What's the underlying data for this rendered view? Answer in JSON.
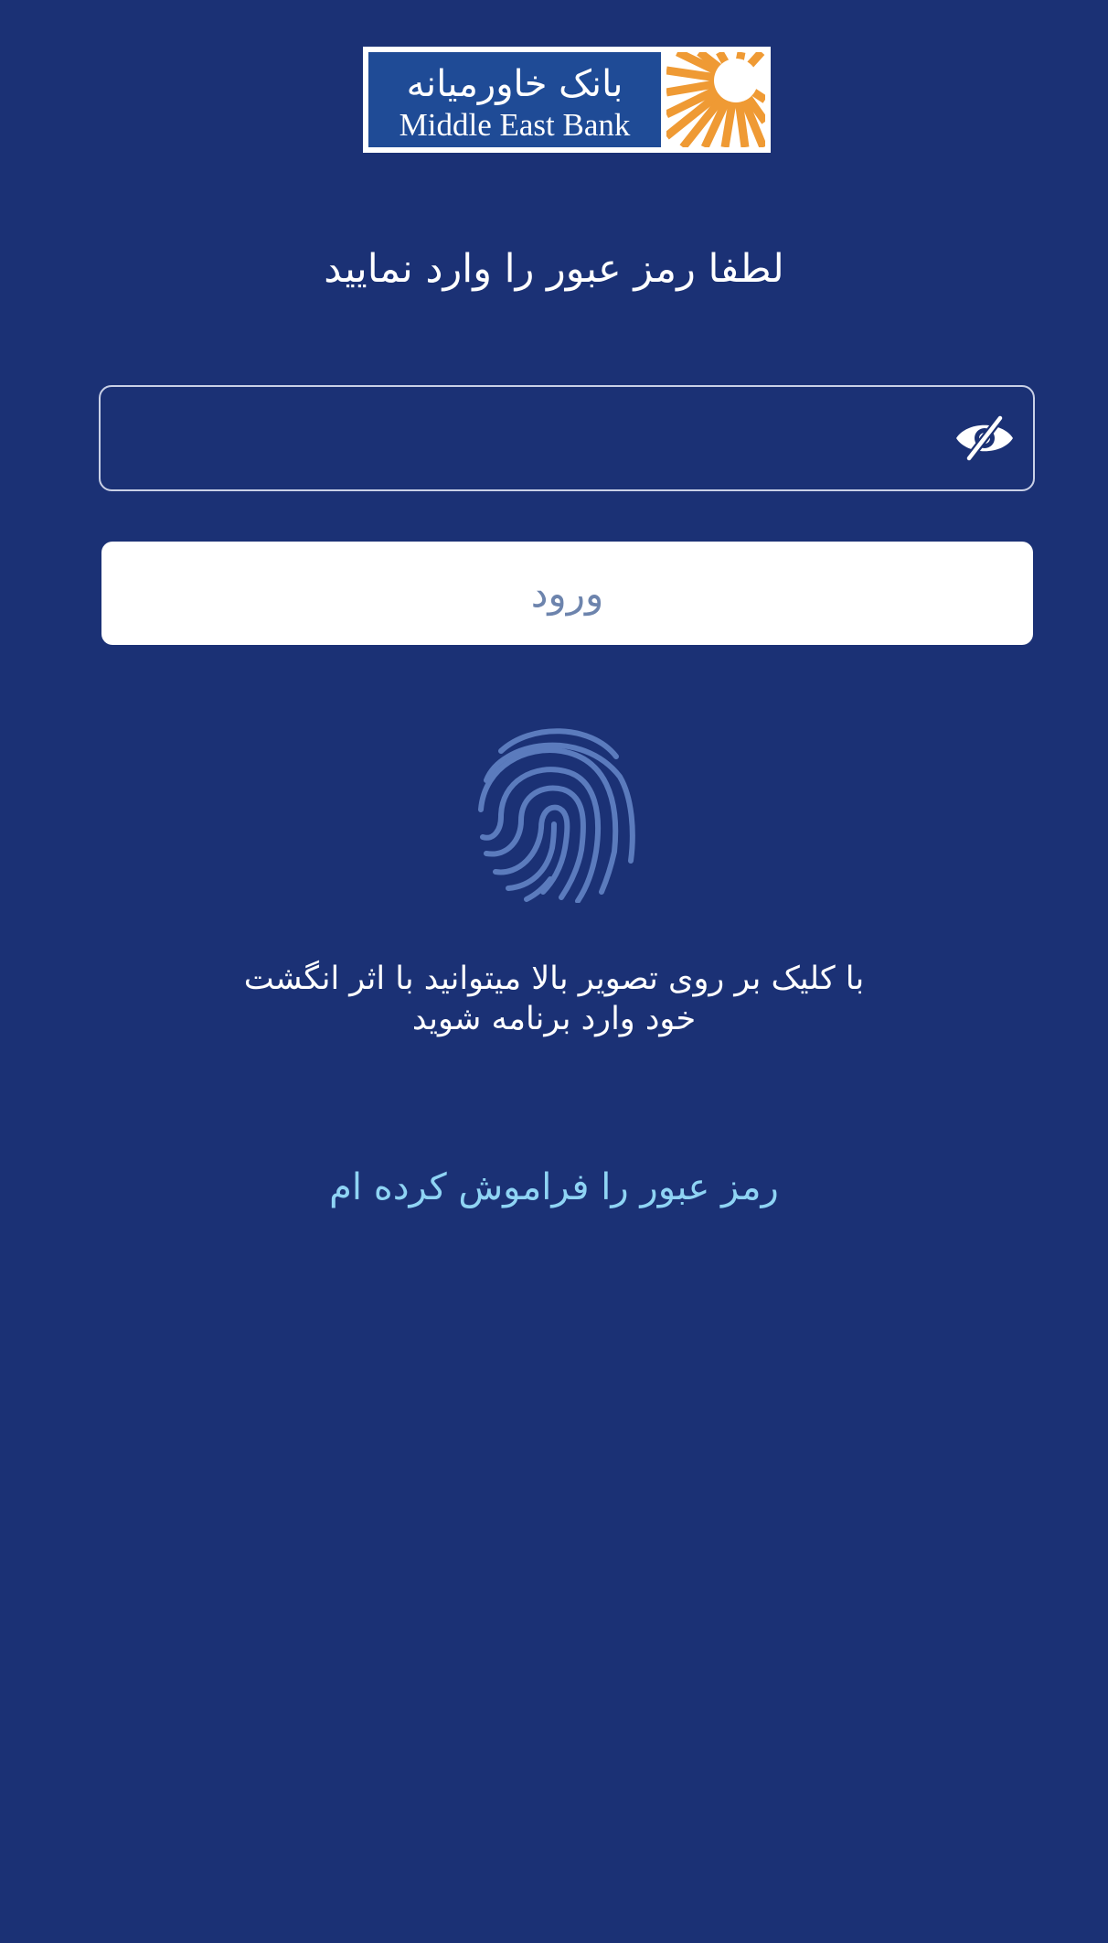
{
  "logo": {
    "name_fa": "بانک خاورمیانه",
    "name_en": "Middle East Bank",
    "icon": "sun-icon",
    "colors": {
      "frame": "#ffffff",
      "panel": "#1f4b96",
      "sun": "#ef9a34"
    }
  },
  "title": "لطفا رمز عبور را وارد نمایید",
  "password": {
    "value": "",
    "placeholder": "",
    "toggle_icon": "eye-slash-icon"
  },
  "login_button": {
    "label": "ورود"
  },
  "fingerprint": {
    "icon": "fingerprint-icon",
    "hint_line1": "با کلیک بر روی تصویر بالا میتوانید با اثر انگشت",
    "hint_line2": "خود وارد برنامه شوید"
  },
  "forgot_password": {
    "label": "رمز عبور را فراموش کرده ام"
  },
  "colors": {
    "background": "#1b3175",
    "button_text": "#6d84ad",
    "link": "#8fd4f4",
    "fingerprint": "#5b7bbd"
  }
}
